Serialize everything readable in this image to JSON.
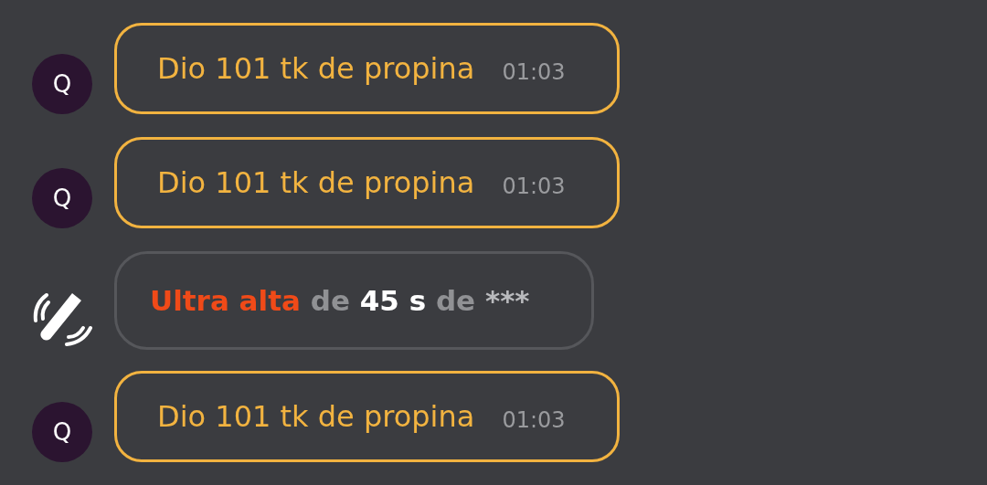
{
  "messages": [
    {
      "kind": "tip",
      "avatar": "Q",
      "text": "Dio 101 tk de propina",
      "time": "01:03"
    },
    {
      "kind": "tip",
      "avatar": "Q",
      "text": "Dio 101 tk de propina",
      "time": "01:03"
    },
    {
      "kind": "event",
      "segments": [
        {
          "color": "#f04a18",
          "text": "Ultra alta"
        },
        {
          "color": "#909194",
          "text": "de"
        },
        {
          "color": "#ffffff",
          "text": "45 s"
        },
        {
          "color": "#909194",
          "text": "de"
        },
        {
          "color": "#b9babd",
          "text": "***"
        }
      ]
    },
    {
      "kind": "tip",
      "avatar": "Q",
      "text": "Dio 101 tk de propina",
      "time": "01:03"
    }
  ]
}
